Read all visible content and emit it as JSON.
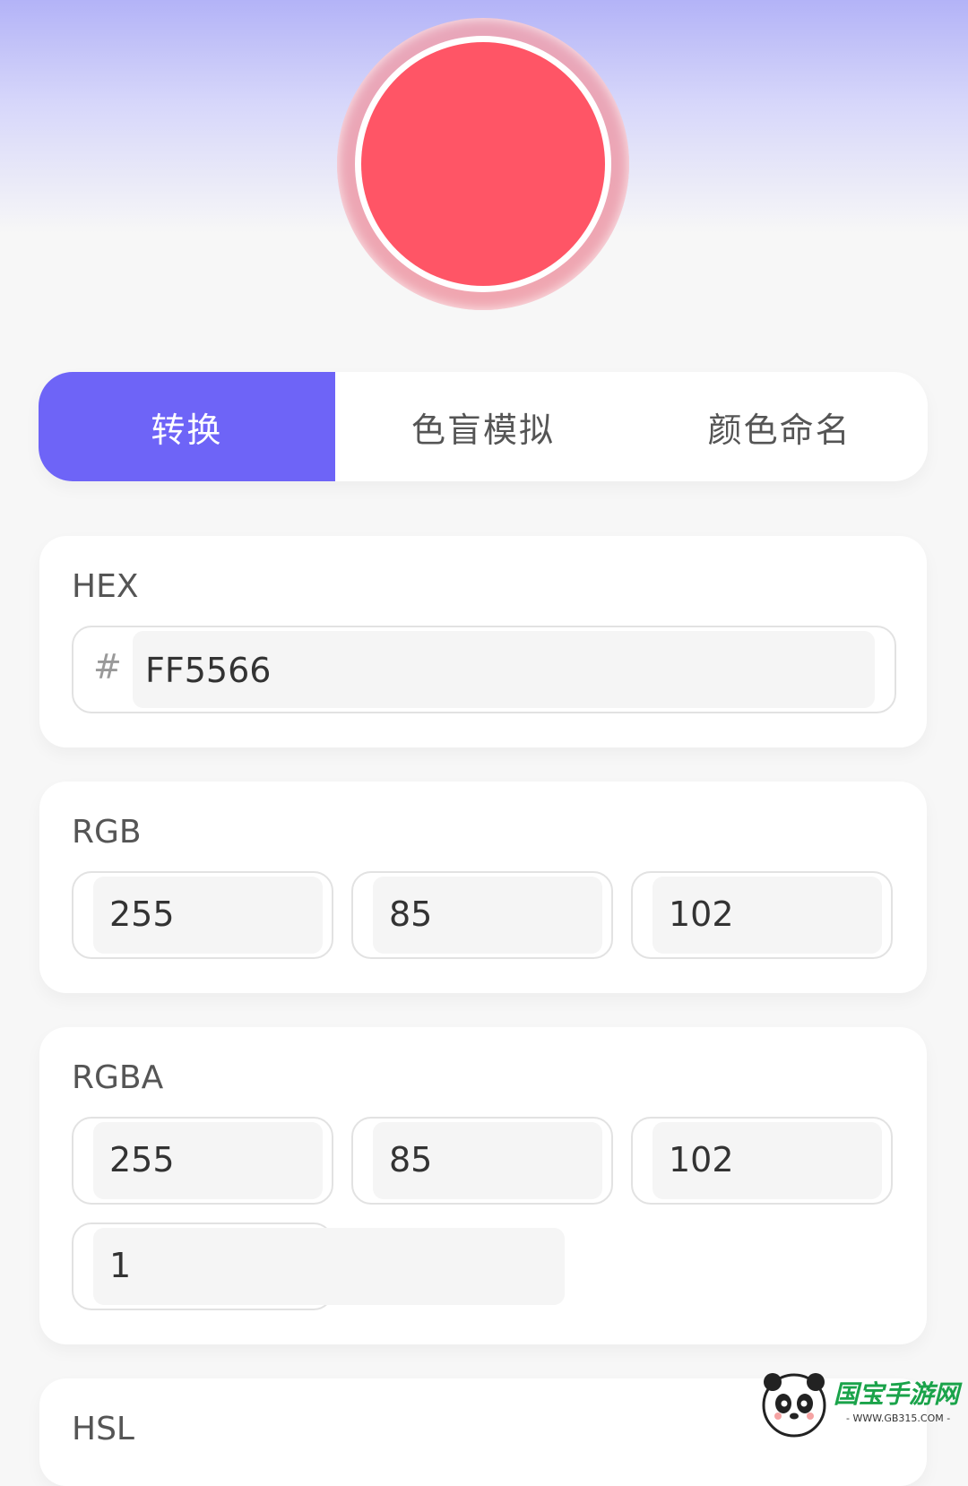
{
  "colors": {
    "selected": "#FF5566",
    "accent": "#6E64F7"
  },
  "tabs": [
    {
      "label": "转换",
      "active": true
    },
    {
      "label": "色盲模拟",
      "active": false
    },
    {
      "label": "颜色命名",
      "active": false
    }
  ],
  "hex": {
    "title": "HEX",
    "prefix": "#",
    "value": "FF5566"
  },
  "rgb": {
    "title": "RGB",
    "r": "255",
    "g": "85",
    "b": "102"
  },
  "rgba": {
    "title": "RGBA",
    "r": "255",
    "g": "85",
    "b": "102",
    "a": "1"
  },
  "hsl": {
    "title": "HSL"
  },
  "watermark": {
    "icon": "panda-icon",
    "name": "国宝手游网",
    "url": "- WWW.GB315.COM -"
  }
}
